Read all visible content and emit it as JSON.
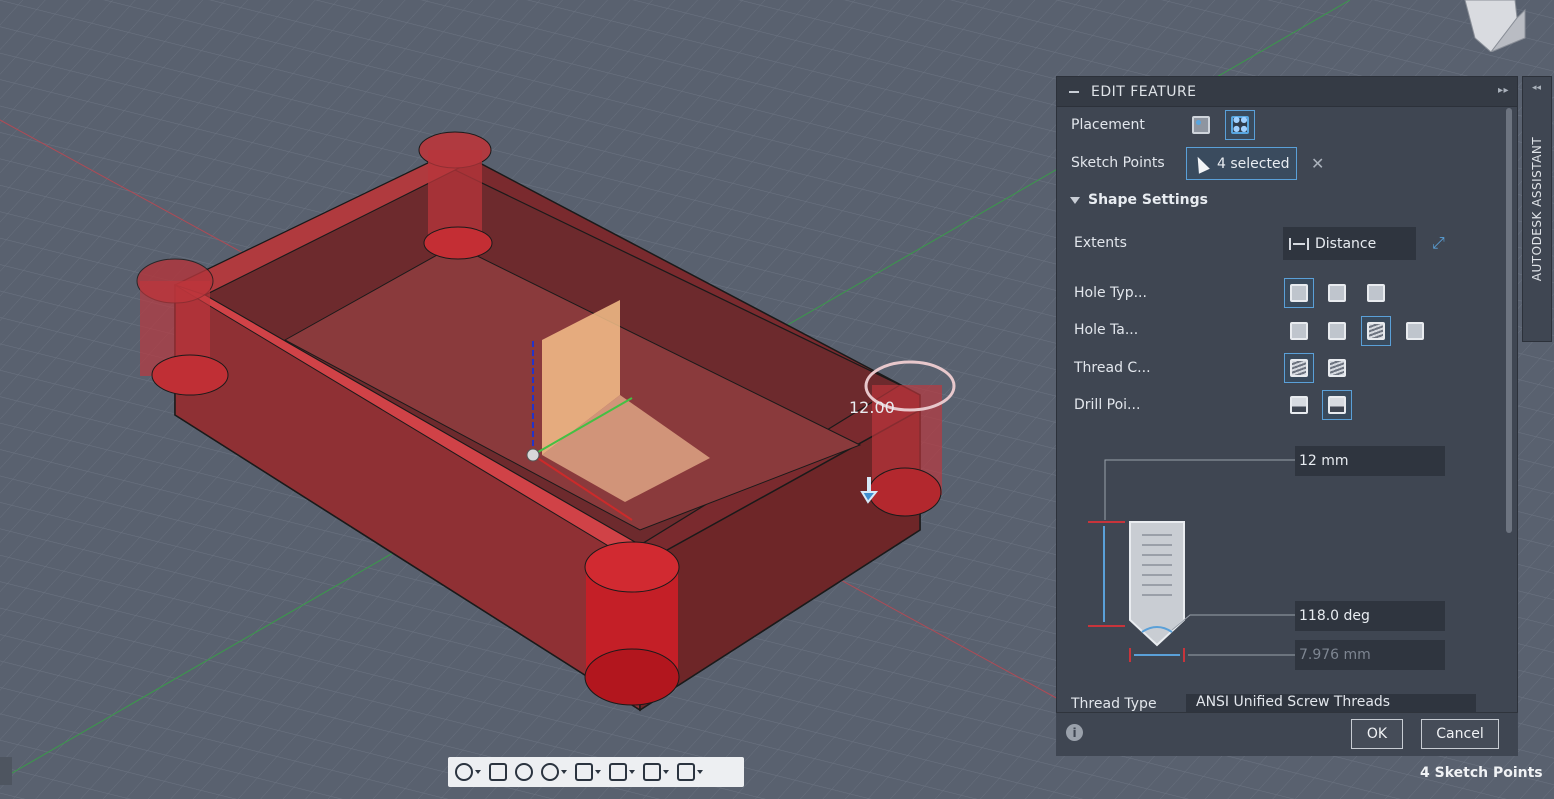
{
  "panel": {
    "title": "EDIT FEATURE",
    "placement_label": "Placement",
    "sketch_points_label": "Sketch Points",
    "selection_text": "4 selected",
    "clear_glyph": "✕",
    "section_title": "Shape Settings",
    "extents_label": "Extents",
    "extents_value": "Distance",
    "flip_glyph": "⤢",
    "hole_type_label": "Hole Typ...",
    "hole_tap_label": "Hole Ta...",
    "thread_label": "Thread C...",
    "drill_point_label": "Drill Poi...",
    "depth_value": "12 mm",
    "angle_value": "118.0 deg",
    "diameter_value": "7.976 mm",
    "thread_type_label": "Thread Type",
    "thread_type_value": "ANSI Unified Screw Threads",
    "info_glyph": "i",
    "ok_label": "OK",
    "cancel_label": "Cancel",
    "expand_glyph": "▸▸"
  },
  "assistant": {
    "label": "AUTODESK ASSISTANT",
    "arrow": "◂◂"
  },
  "viewport": {
    "dimension_label": "12.00"
  },
  "status": {
    "text": "4 Sketch Points"
  },
  "icons": [
    "orbit-icon",
    "look-at-icon",
    "pan-icon",
    "zoom-icon",
    "fit-icon",
    "display-icon",
    "grid-icon",
    "viewports-icon"
  ],
  "colors": {
    "accent": "#5aa0d8",
    "body": "#8c2f33",
    "panel": "#3f4652",
    "grid": "#5b6371"
  }
}
